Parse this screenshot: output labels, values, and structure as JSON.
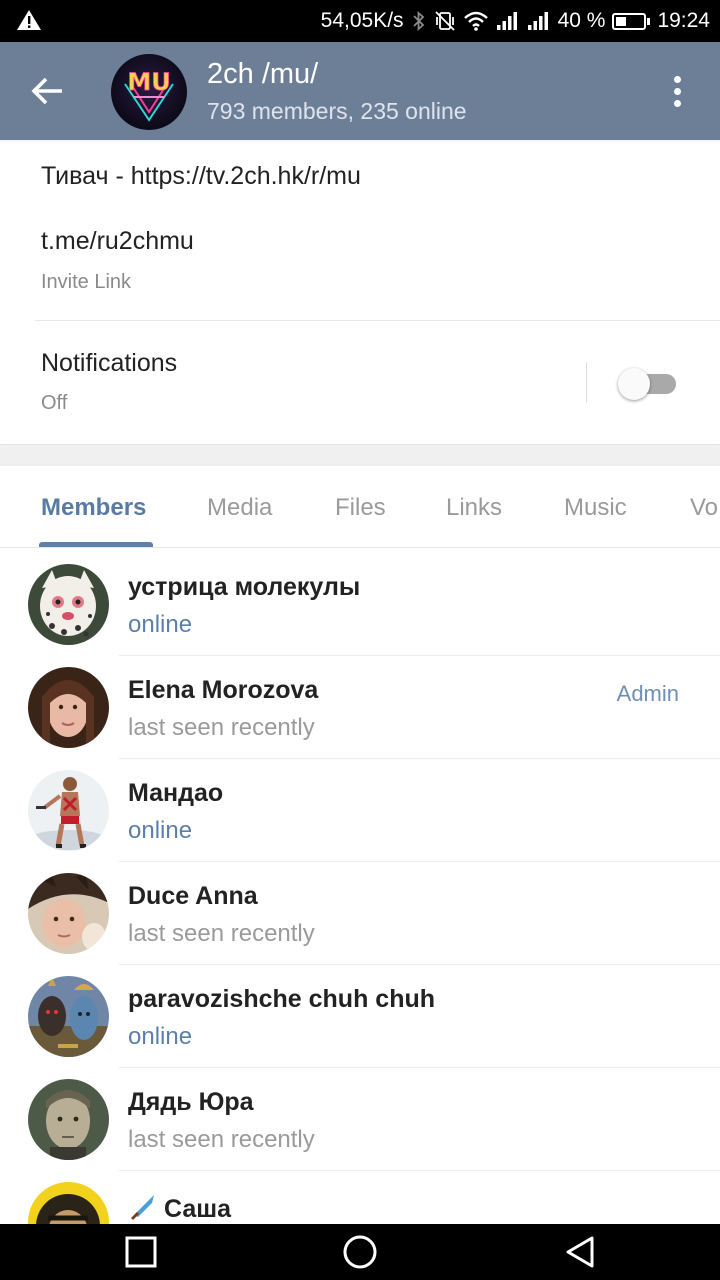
{
  "status_bar": {
    "net_speed": "54,05K/s",
    "battery_percent_text": "40 %",
    "battery_level": 0.4,
    "time": "19:24",
    "icons": [
      "warning-icon",
      "bluetooth-icon",
      "vibrate-icon",
      "wifi-icon",
      "signal-icon",
      "signal-icon",
      "battery-icon"
    ]
  },
  "header": {
    "title": "2ch /mu/",
    "subtitle": "793 members, 235 online",
    "avatar_text": "MU"
  },
  "info": {
    "description": "Тивач - https://tv.2ch.hk/r/mu",
    "invite_link": "t.me/ru2chmu",
    "invite_label": "Invite Link",
    "notifications_title": "Notifications",
    "notifications_value": "Off",
    "notifications_enabled": false
  },
  "tabs": [
    {
      "label": "Members",
      "active": true
    },
    {
      "label": "Media",
      "active": false
    },
    {
      "label": "Files",
      "active": false
    },
    {
      "label": "Links",
      "active": false
    },
    {
      "label": "Music",
      "active": false
    },
    {
      "label": "Vo",
      "active": false
    }
  ],
  "members": [
    {
      "name": "устрица молекулы",
      "status": "online",
      "online": true,
      "role": ""
    },
    {
      "name": "Elena Morozova",
      "status": "last seen recently",
      "online": false,
      "role": "Admin"
    },
    {
      "name": "Мандао",
      "status": "online",
      "online": true,
      "role": ""
    },
    {
      "name": "Duce Anna",
      "status": "last seen recently",
      "online": false,
      "role": ""
    },
    {
      "name": "paravozishche chuh chuh",
      "status": "online",
      "online": true,
      "role": ""
    },
    {
      "name": "Дядь Юра",
      "status": "last seen recently",
      "online": false,
      "role": ""
    },
    {
      "name": "Саша",
      "status": "",
      "online": false,
      "role": "",
      "emoji": "knife-icon"
    }
  ],
  "colors": {
    "header_bg": "#6d7f97",
    "accent": "#5b80ab",
    "online": "#5b7fa8",
    "admin": "#6f8fb4"
  }
}
